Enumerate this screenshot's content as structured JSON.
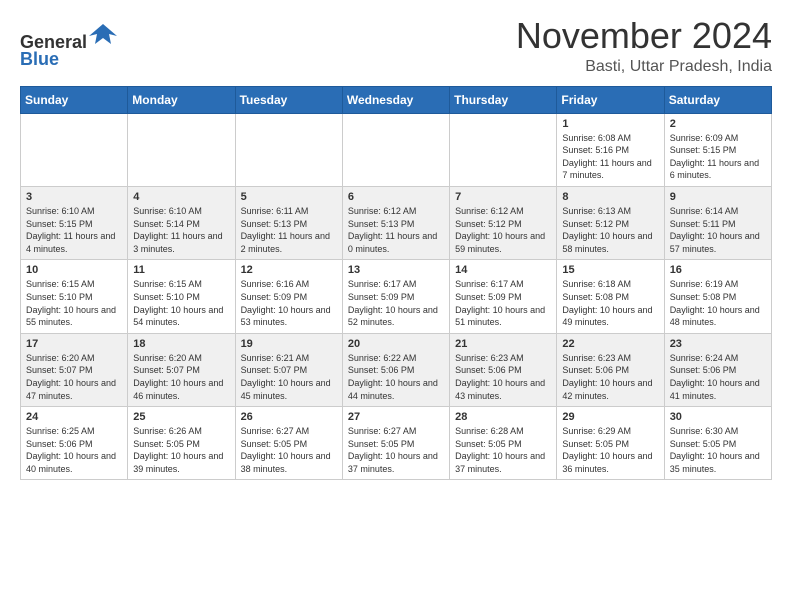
{
  "header": {
    "logo_line1": "General",
    "logo_line2": "Blue",
    "month_title": "November 2024",
    "location": "Basti, Uttar Pradesh, India"
  },
  "weekdays": [
    "Sunday",
    "Monday",
    "Tuesday",
    "Wednesday",
    "Thursday",
    "Friday",
    "Saturday"
  ],
  "weeks": [
    [
      {
        "day": "",
        "info": ""
      },
      {
        "day": "",
        "info": ""
      },
      {
        "day": "",
        "info": ""
      },
      {
        "day": "",
        "info": ""
      },
      {
        "day": "",
        "info": ""
      },
      {
        "day": "1",
        "info": "Sunrise: 6:08 AM\nSunset: 5:16 PM\nDaylight: 11 hours and 7 minutes."
      },
      {
        "day": "2",
        "info": "Sunrise: 6:09 AM\nSunset: 5:15 PM\nDaylight: 11 hours and 6 minutes."
      }
    ],
    [
      {
        "day": "3",
        "info": "Sunrise: 6:10 AM\nSunset: 5:15 PM\nDaylight: 11 hours and 4 minutes."
      },
      {
        "day": "4",
        "info": "Sunrise: 6:10 AM\nSunset: 5:14 PM\nDaylight: 11 hours and 3 minutes."
      },
      {
        "day": "5",
        "info": "Sunrise: 6:11 AM\nSunset: 5:13 PM\nDaylight: 11 hours and 2 minutes."
      },
      {
        "day": "6",
        "info": "Sunrise: 6:12 AM\nSunset: 5:13 PM\nDaylight: 11 hours and 0 minutes."
      },
      {
        "day": "7",
        "info": "Sunrise: 6:12 AM\nSunset: 5:12 PM\nDaylight: 10 hours and 59 minutes."
      },
      {
        "day": "8",
        "info": "Sunrise: 6:13 AM\nSunset: 5:12 PM\nDaylight: 10 hours and 58 minutes."
      },
      {
        "day": "9",
        "info": "Sunrise: 6:14 AM\nSunset: 5:11 PM\nDaylight: 10 hours and 57 minutes."
      }
    ],
    [
      {
        "day": "10",
        "info": "Sunrise: 6:15 AM\nSunset: 5:10 PM\nDaylight: 10 hours and 55 minutes."
      },
      {
        "day": "11",
        "info": "Sunrise: 6:15 AM\nSunset: 5:10 PM\nDaylight: 10 hours and 54 minutes."
      },
      {
        "day": "12",
        "info": "Sunrise: 6:16 AM\nSunset: 5:09 PM\nDaylight: 10 hours and 53 minutes."
      },
      {
        "day": "13",
        "info": "Sunrise: 6:17 AM\nSunset: 5:09 PM\nDaylight: 10 hours and 52 minutes."
      },
      {
        "day": "14",
        "info": "Sunrise: 6:17 AM\nSunset: 5:09 PM\nDaylight: 10 hours and 51 minutes."
      },
      {
        "day": "15",
        "info": "Sunrise: 6:18 AM\nSunset: 5:08 PM\nDaylight: 10 hours and 49 minutes."
      },
      {
        "day": "16",
        "info": "Sunrise: 6:19 AM\nSunset: 5:08 PM\nDaylight: 10 hours and 48 minutes."
      }
    ],
    [
      {
        "day": "17",
        "info": "Sunrise: 6:20 AM\nSunset: 5:07 PM\nDaylight: 10 hours and 47 minutes."
      },
      {
        "day": "18",
        "info": "Sunrise: 6:20 AM\nSunset: 5:07 PM\nDaylight: 10 hours and 46 minutes."
      },
      {
        "day": "19",
        "info": "Sunrise: 6:21 AM\nSunset: 5:07 PM\nDaylight: 10 hours and 45 minutes."
      },
      {
        "day": "20",
        "info": "Sunrise: 6:22 AM\nSunset: 5:06 PM\nDaylight: 10 hours and 44 minutes."
      },
      {
        "day": "21",
        "info": "Sunrise: 6:23 AM\nSunset: 5:06 PM\nDaylight: 10 hours and 43 minutes."
      },
      {
        "day": "22",
        "info": "Sunrise: 6:23 AM\nSunset: 5:06 PM\nDaylight: 10 hours and 42 minutes."
      },
      {
        "day": "23",
        "info": "Sunrise: 6:24 AM\nSunset: 5:06 PM\nDaylight: 10 hours and 41 minutes."
      }
    ],
    [
      {
        "day": "24",
        "info": "Sunrise: 6:25 AM\nSunset: 5:06 PM\nDaylight: 10 hours and 40 minutes."
      },
      {
        "day": "25",
        "info": "Sunrise: 6:26 AM\nSunset: 5:05 PM\nDaylight: 10 hours and 39 minutes."
      },
      {
        "day": "26",
        "info": "Sunrise: 6:27 AM\nSunset: 5:05 PM\nDaylight: 10 hours and 38 minutes."
      },
      {
        "day": "27",
        "info": "Sunrise: 6:27 AM\nSunset: 5:05 PM\nDaylight: 10 hours and 37 minutes."
      },
      {
        "day": "28",
        "info": "Sunrise: 6:28 AM\nSunset: 5:05 PM\nDaylight: 10 hours and 37 minutes."
      },
      {
        "day": "29",
        "info": "Sunrise: 6:29 AM\nSunset: 5:05 PM\nDaylight: 10 hours and 36 minutes."
      },
      {
        "day": "30",
        "info": "Sunrise: 6:30 AM\nSunset: 5:05 PM\nDaylight: 10 hours and 35 minutes."
      }
    ]
  ]
}
